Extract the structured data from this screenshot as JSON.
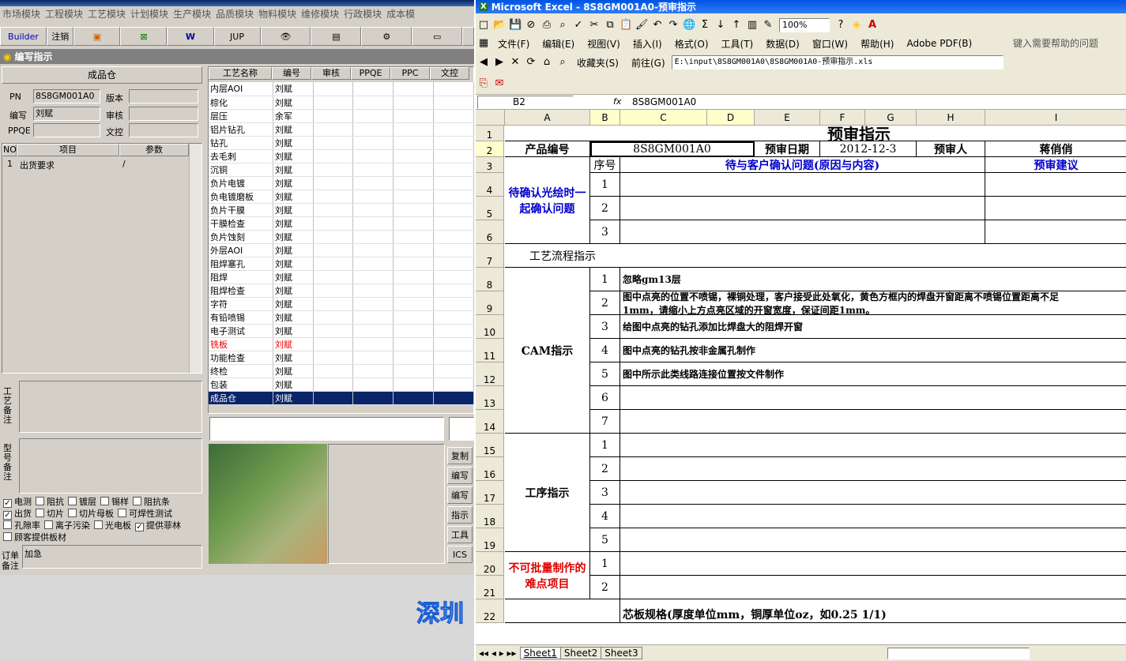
{
  "left_app": {
    "menu": [
      "市场模块",
      "工程模块",
      "工艺模块",
      "计划模块",
      "生产模块",
      "品质模块",
      "物料模块",
      "维修模块",
      "行政模块",
      "成本模"
    ],
    "toolbar": {
      "builder": "Builder",
      "logout": "注销",
      "jup": "JUP"
    },
    "subtitle": "编写指示",
    "form": {
      "section": "成品仓",
      "pn_label": "PN",
      "pn_value": "8S8GM001A0",
      "version_label": "版本",
      "writer_label": "编写",
      "writer_value": "刘赋",
      "review_label": "审核",
      "ppqe_label": "PPQE",
      "doc_label": "文控"
    },
    "items_grid": {
      "headers": [
        "NO",
        "项目",
        "参数"
      ],
      "rows": [
        {
          "no": "1",
          "item": "出货要求",
          "param": "/"
        }
      ]
    },
    "process_grid": {
      "headers": [
        "工艺名称",
        "编号",
        "审核",
        "PPQE",
        "PPC",
        "文控"
      ],
      "rows": [
        [
          "内层AOI",
          "刘赋"
        ],
        [
          "棕化",
          "刘赋"
        ],
        [
          "层压",
          "余军"
        ],
        [
          "铝片钻孔",
          "刘赋"
        ],
        [
          "钻孔",
          "刘赋"
        ],
        [
          "去毛刺",
          "刘赋"
        ],
        [
          "沉铜",
          "刘赋"
        ],
        [
          "负片电镀",
          "刘赋"
        ],
        [
          "负电镀磨板",
          "刘赋"
        ],
        [
          "负片干膜",
          "刘赋"
        ],
        [
          "干膜检查",
          "刘赋"
        ],
        [
          "负片蚀刻",
          "刘赋"
        ],
        [
          "外层AOI",
          "刘赋"
        ],
        [
          "阻焊塞孔",
          "刘赋"
        ],
        [
          "阻焊",
          "刘赋"
        ],
        [
          "阻焊检查",
          "刘赋"
        ],
        [
          "字符",
          "刘赋"
        ],
        [
          "有铅喷锡",
          "刘赋"
        ],
        [
          "电子测试",
          "刘赋"
        ],
        [
          "铣板",
          "刘赋"
        ],
        [
          "功能检查",
          "刘赋"
        ],
        [
          "终检",
          "刘赋"
        ],
        [
          "包装",
          "刘赋"
        ],
        [
          "成品仓",
          "刘赋"
        ]
      ],
      "highlight_red_index": 19,
      "selected_index": 23
    },
    "notes": {
      "process_note": "工艺备注",
      "model_note": "型号备注",
      "order_note": "订单备注",
      "order_value": "加急"
    },
    "checks": [
      {
        "label": "电测",
        "checked": true
      },
      {
        "label": "阻抗",
        "checked": false
      },
      {
        "label": "镀层",
        "checked": false
      },
      {
        "label": "锡样",
        "checked": false
      },
      {
        "label": "阻抗条",
        "checked": false
      },
      {
        "label": "出货",
        "checked": true
      },
      {
        "label": "切片",
        "checked": false
      },
      {
        "label": "切片母板",
        "checked": false
      },
      {
        "label": "可焊性测试",
        "checked": false
      },
      {
        "label": "孔隙率",
        "checked": false
      },
      {
        "label": "离子污染",
        "checked": false
      },
      {
        "label": "光电板",
        "checked": false
      },
      {
        "label": "提供菲林",
        "checked": true
      },
      {
        "label": "顾客提供板材",
        "checked": false
      }
    ],
    "side_buttons": [
      "复制",
      "编写",
      "编写",
      "指示",
      "工具",
      "ICS"
    ],
    "watermark": "深圳"
  },
  "excel": {
    "title": "Microsoft Excel - 8S8GM001A0-预审指示",
    "menu": [
      "文件(F)",
      "编辑(E)",
      "视图(V)",
      "插入(I)",
      "格式(O)",
      "工具(T)",
      "数据(D)",
      "窗口(W)",
      "帮助(H)",
      "Adobe PDF(B)"
    ],
    "help_placeholder": "键入需要帮助的问题",
    "zoom": "100%",
    "web": {
      "favorites": "收藏夹(S)",
      "goto": "前往(G)",
      "path": "E:\\input\\8S8GM001A0\\8S8GM001A0-预审指示.xls"
    },
    "namebox": "B2",
    "fx": "fx",
    "formula": "8S8GM001A0",
    "columns": [
      "A",
      "B",
      "C",
      "D",
      "E",
      "F",
      "G",
      "H",
      "I"
    ],
    "rows": [
      "1",
      "2",
      "3",
      "4",
      "5",
      "6",
      "7",
      "8",
      "9",
      "10",
      "11",
      "12",
      "13",
      "14",
      "15",
      "16",
      "17",
      "18",
      "19",
      "20",
      "21",
      "22"
    ],
    "cells": {
      "title": "预审指示",
      "product_no_label": "产品编号",
      "product_no": "8S8GM001A0",
      "date_label": "预审日期",
      "date": "2012-12-3",
      "reviewer_label": "预审人",
      "reviewer": "蒋俏俏",
      "seq": "序号",
      "issues": "待与客户确认问题(原因与内容)",
      "suggest": "预审建议",
      "confirm_group": "待确认光绘时一起确认问题",
      "flow_title": "工艺流程指示",
      "cam": "CAM指示",
      "proc": "工序指示",
      "hard": "不可批量制作的难点项目",
      "cam1": "忽略gm13层",
      "cam2a": "图中点亮的位置不喷锡，裸铜处理，客户接受此处氧化，黄色方框内的焊盘开窗距离不喷锡位置距离不足",
      "cam2b": "1mm，请缩小上方点亮区域的开窗宽度，保证间距1mm。",
      "cam3": "给图中点亮的钻孔添加比焊盘大的阻焊开窗",
      "cam4": "图中点亮的钻孔按非金属孔制作",
      "cam5": "图中所示此类线路连接位置按文件制作",
      "row22": "芯板规格(厚度单位mm，铜厚单位oz，如0.25 1/1)"
    },
    "nums": [
      "1",
      "2",
      "3",
      "1",
      "2",
      "3",
      "4",
      "5",
      "6",
      "7",
      "1",
      "2",
      "3",
      "4",
      "5",
      "1",
      "2"
    ],
    "sheets": [
      "Sheet1",
      "Sheet2",
      "Sheet3"
    ]
  }
}
